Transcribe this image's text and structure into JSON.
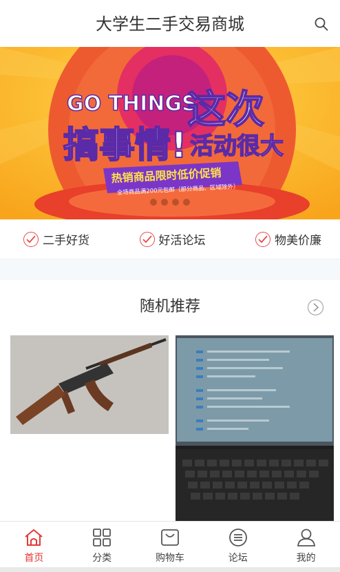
{
  "header": {
    "title": "大学生二手交易商城",
    "search_icon": "search-icon"
  },
  "banner": {
    "headline_en": "GO THINGS",
    "headline_cn": "搞事情!",
    "headline_cn2": "这次",
    "headline_cn3": "活动很大",
    "ribbon": "热销商品限时低价促销",
    "sub": "全场商品满200元包邮（部分商品、区域除外）",
    "slides": 4,
    "active_slide": 0
  },
  "features": [
    {
      "label": "二手好货"
    },
    {
      "label": "好活论坛"
    },
    {
      "label": "物美价廉"
    }
  ],
  "section": {
    "title": "随机推荐"
  },
  "tabbar": [
    {
      "label": "首页",
      "icon": "home-icon",
      "active": true
    },
    {
      "label": "分类",
      "icon": "grid-icon",
      "active": false
    },
    {
      "label": "购物车",
      "icon": "bag-icon",
      "active": false
    },
    {
      "label": "论坛",
      "icon": "forum-icon",
      "active": false
    },
    {
      "label": "我的",
      "icon": "user-icon",
      "active": false
    }
  ],
  "colors": {
    "accent": "#e53935",
    "banner_bg": "#fbb224"
  }
}
